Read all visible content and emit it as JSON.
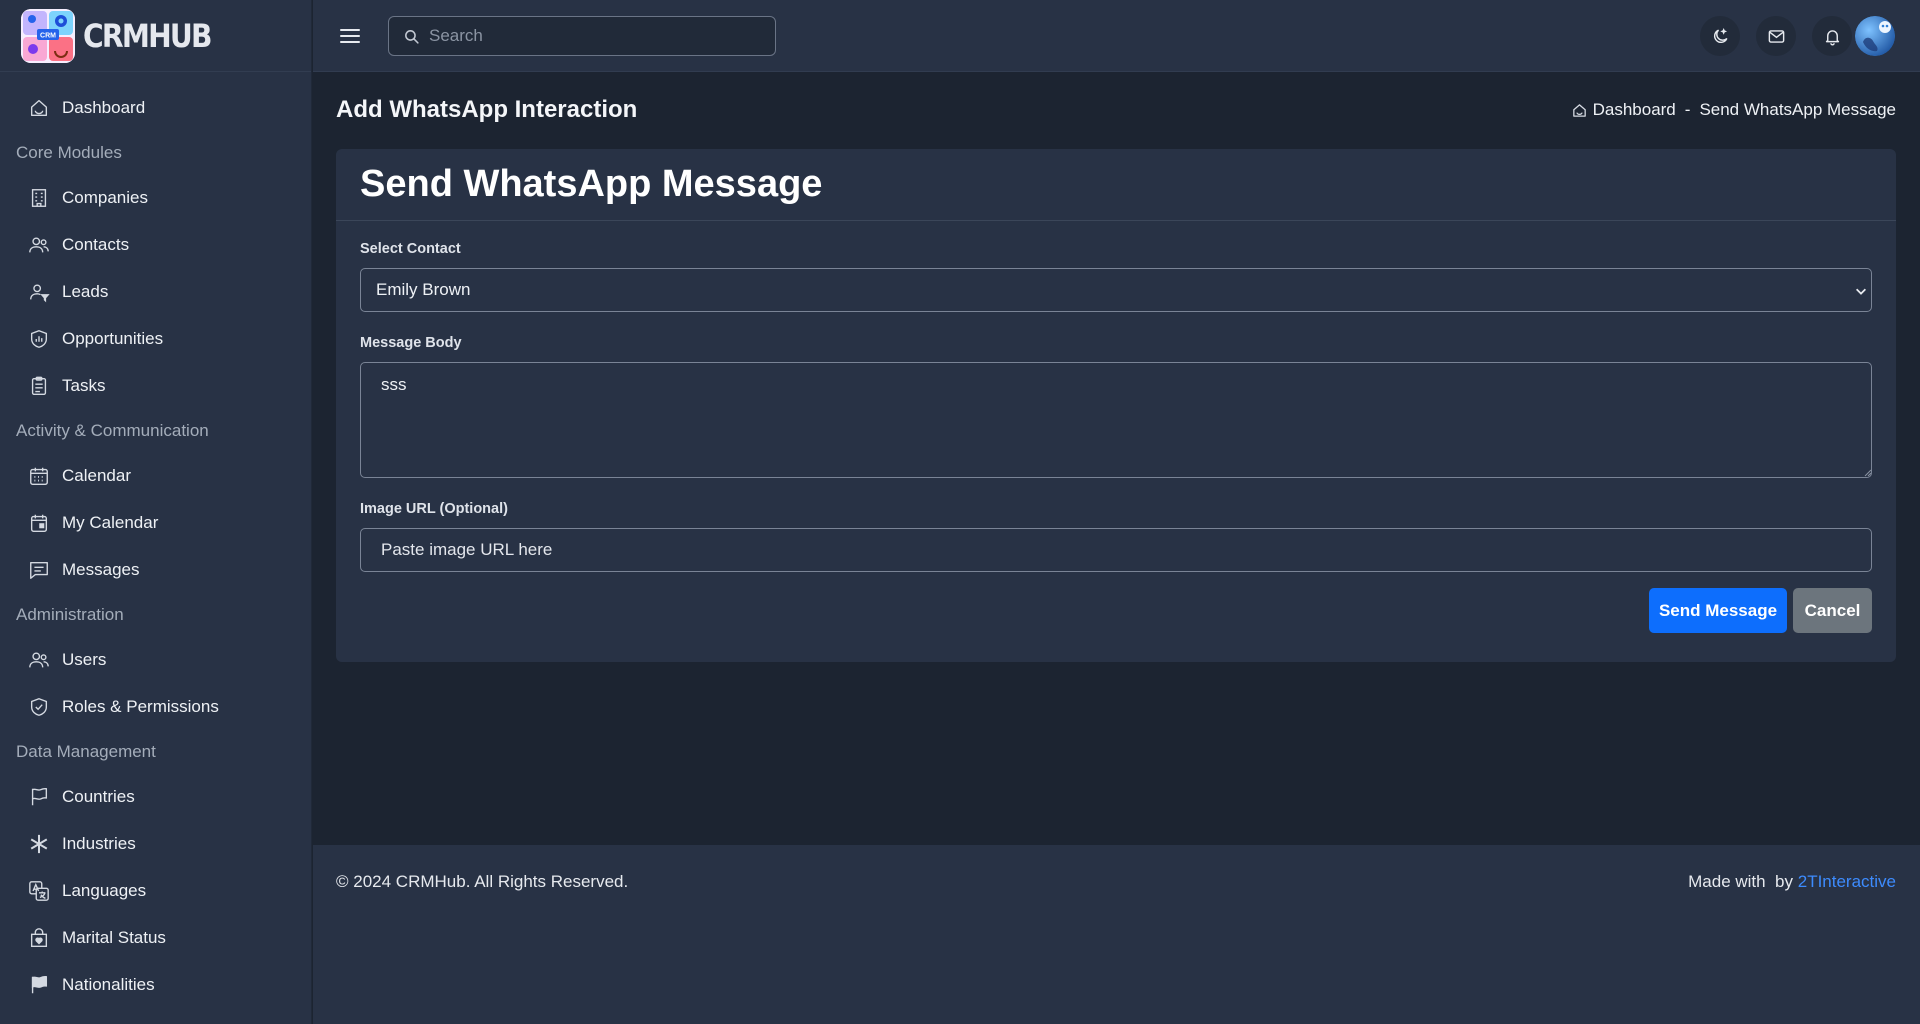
{
  "brand": {
    "name": "CRMHUB",
    "logo_badge": "CRM"
  },
  "sidebar": {
    "items": [
      {
        "type": "item",
        "label": "Dashboard",
        "icon": "dashboard-icon"
      },
      {
        "type": "section",
        "label": "Core Modules"
      },
      {
        "type": "item",
        "label": "Companies",
        "icon": "building-icon"
      },
      {
        "type": "item",
        "label": "Contacts",
        "icon": "people-icon"
      },
      {
        "type": "item",
        "label": "Leads",
        "icon": "person-filter-icon"
      },
      {
        "type": "item",
        "label": "Opportunities",
        "icon": "chart-shield-icon"
      },
      {
        "type": "item",
        "label": "Tasks",
        "icon": "clipboard-icon"
      },
      {
        "type": "section",
        "label": "Activity & Communication"
      },
      {
        "type": "item",
        "label": "Calendar",
        "icon": "calendar-icon"
      },
      {
        "type": "item",
        "label": "My Calendar",
        "icon": "calendar-event-icon"
      },
      {
        "type": "item",
        "label": "Messages",
        "icon": "chat-icon"
      },
      {
        "type": "section",
        "label": "Administration"
      },
      {
        "type": "item",
        "label": "Users",
        "icon": "people-icon"
      },
      {
        "type": "item",
        "label": "Roles & Permissions",
        "icon": "shield-check-icon"
      },
      {
        "type": "section",
        "label": "Data Management"
      },
      {
        "type": "item",
        "label": "Countries",
        "icon": "flag-icon"
      },
      {
        "type": "item",
        "label": "Industries",
        "icon": "asterisk-icon"
      },
      {
        "type": "item",
        "label": "Languages",
        "icon": "translate-icon"
      },
      {
        "type": "item",
        "label": "Marital Status",
        "icon": "bag-heart-icon"
      },
      {
        "type": "item",
        "label": "Nationalities",
        "icon": "flag-fill-icon"
      }
    ]
  },
  "header": {
    "search_placeholder": "Search",
    "buttons": [
      "theme-toggle-icon",
      "mail-icon",
      "bell-icon"
    ]
  },
  "page": {
    "title": "Add WhatsApp Interaction",
    "breadcrumb": {
      "home": "Dashboard",
      "separator": "-",
      "current": "Send WhatsApp Message"
    }
  },
  "form": {
    "title": "Send WhatsApp Message",
    "contact_label": "Select Contact",
    "contact_value": "Emily Brown",
    "message_label": "Message Body",
    "message_value": "sss",
    "image_label": "Image URL (Optional)",
    "image_placeholder": "Paste image URL here",
    "send_label": "Send Message",
    "cancel_label": "Cancel"
  },
  "footer": {
    "copyright": "© 2024 CRMHub. All Rights Reserved.",
    "made_with": "Made with  by ",
    "company": "2TInteractive"
  },
  "colors": {
    "primary": "#0d6efd",
    "secondary": "#6c757d",
    "link": "#3d8bfd",
    "sidebar_bg": "#283245",
    "page_bg": "#1c2431"
  }
}
